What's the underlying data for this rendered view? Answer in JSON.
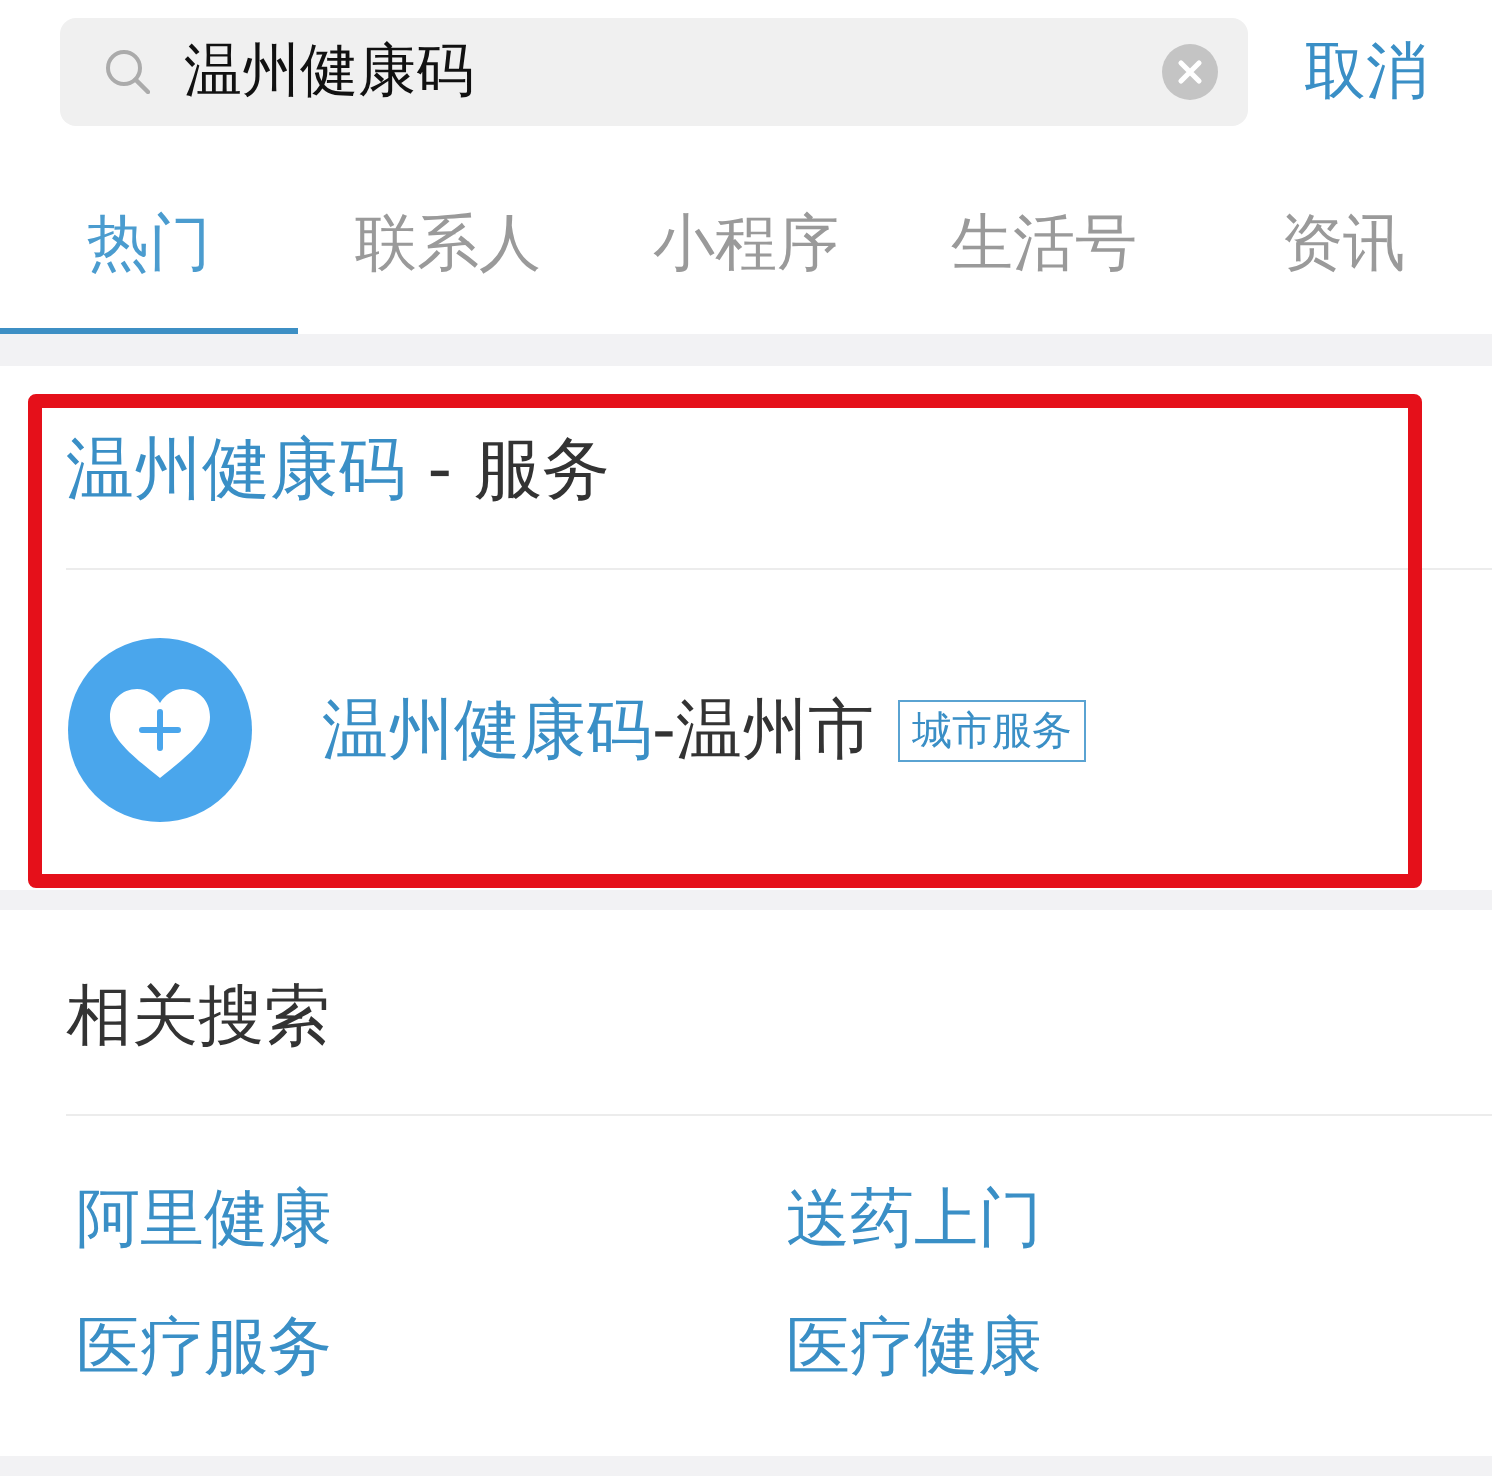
{
  "search": {
    "value": "温州健康码",
    "cancel": "取消"
  },
  "tabs": [
    {
      "label": "热门",
      "selected": true
    },
    {
      "label": "联系人",
      "selected": false
    },
    {
      "label": "小程序",
      "selected": false
    },
    {
      "label": "生活号",
      "selected": false
    },
    {
      "label": "资讯",
      "selected": false
    }
  ],
  "service_card": {
    "highlighted": true,
    "heading": {
      "match": "温州健康码",
      "rest": " - 服务"
    },
    "results": [
      {
        "title_match": "温州健康码",
        "title_rest": "-温州市",
        "tag": "城市服务"
      }
    ]
  },
  "related_searches": {
    "title": "相关搜索",
    "items": [
      "阿里健康",
      "送药上门",
      "医疗服务",
      "医疗健康"
    ]
  }
}
